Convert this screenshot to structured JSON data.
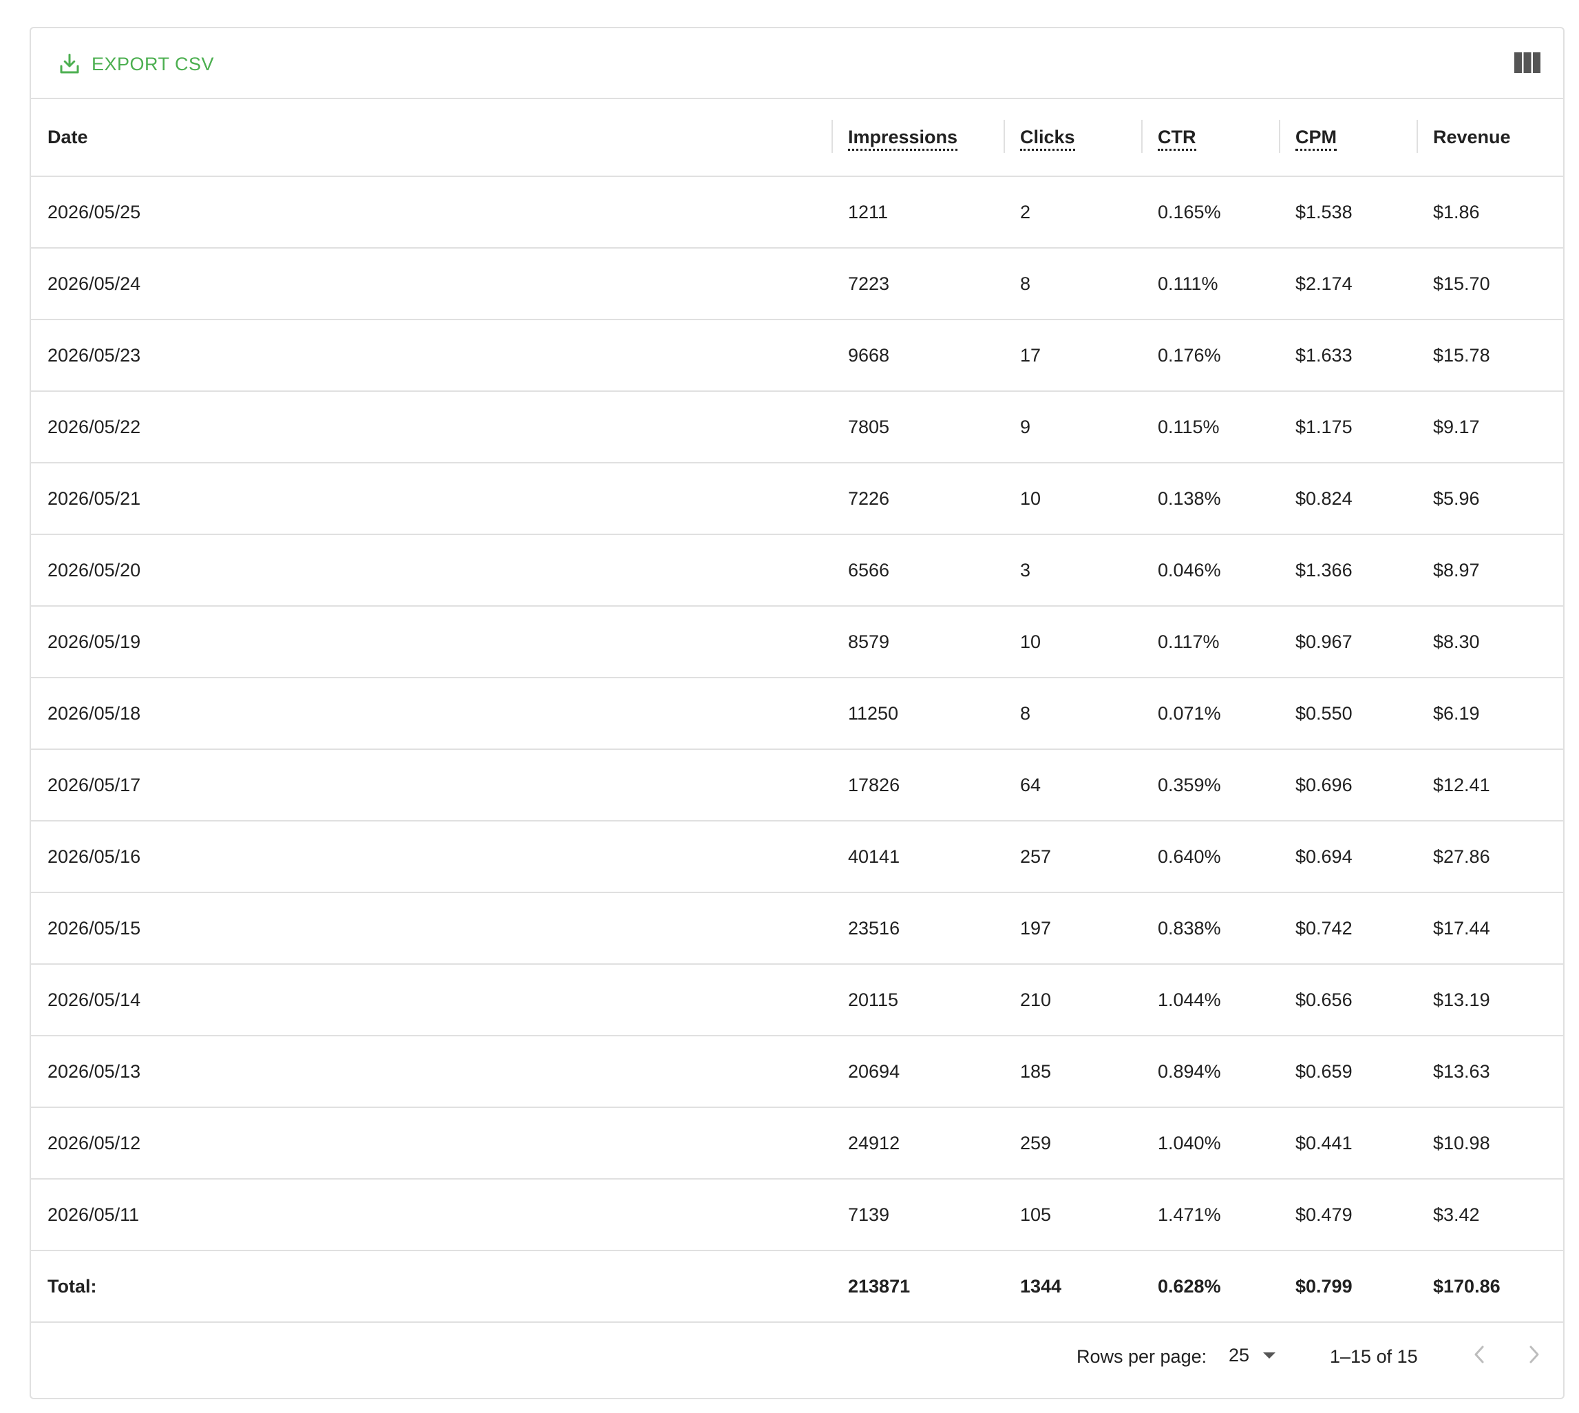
{
  "toolbar": {
    "export_label": "EXPORT CSV",
    "export_icon": "download-icon",
    "columns_icon": "view-columns-icon",
    "accent_color": "#4caf50"
  },
  "table": {
    "columns": [
      "Date",
      "Impressions",
      "Clicks",
      "CTR",
      "CPM",
      "Revenue"
    ],
    "rows": [
      [
        "2026/05/25",
        "1211",
        "2",
        "0.165%",
        "$1.538",
        "$1.86"
      ],
      [
        "2026/05/24",
        "7223",
        "8",
        "0.111%",
        "$2.174",
        "$15.70"
      ],
      [
        "2026/05/23",
        "9668",
        "17",
        "0.176%",
        "$1.633",
        "$15.78"
      ],
      [
        "2026/05/22",
        "7805",
        "9",
        "0.115%",
        "$1.175",
        "$9.17"
      ],
      [
        "2026/05/21",
        "7226",
        "10",
        "0.138%",
        "$0.824",
        "$5.96"
      ],
      [
        "2026/05/20",
        "6566",
        "3",
        "0.046%",
        "$1.366",
        "$8.97"
      ],
      [
        "2026/05/19",
        "8579",
        "10",
        "0.117%",
        "$0.967",
        "$8.30"
      ],
      [
        "2026/05/18",
        "11250",
        "8",
        "0.071%",
        "$0.550",
        "$6.19"
      ],
      [
        "2026/05/17",
        "17826",
        "64",
        "0.359%",
        "$0.696",
        "$12.41"
      ],
      [
        "2026/05/16",
        "40141",
        "257",
        "0.640%",
        "$0.694",
        "$27.86"
      ],
      [
        "2026/05/15",
        "23516",
        "197",
        "0.838%",
        "$0.742",
        "$17.44"
      ],
      [
        "2026/05/14",
        "20115",
        "210",
        "1.044%",
        "$0.656",
        "$13.19"
      ],
      [
        "2026/05/13",
        "20694",
        "185",
        "0.894%",
        "$0.659",
        "$13.63"
      ],
      [
        "2026/05/12",
        "24912",
        "259",
        "1.040%",
        "$0.441",
        "$10.98"
      ],
      [
        "2026/05/11",
        "7139",
        "105",
        "1.471%",
        "$0.479",
        "$3.42"
      ]
    ],
    "total": [
      "Total:",
      "213871",
      "1344",
      "0.628%",
      "$0.799",
      "$170.86"
    ]
  },
  "footer": {
    "rows_per_page_label": "Rows per page:",
    "rows_per_page_value": "25",
    "range_text": "1–15 of 15",
    "prev_icon": "chevron-left-icon",
    "next_icon": "chevron-right-icon"
  }
}
